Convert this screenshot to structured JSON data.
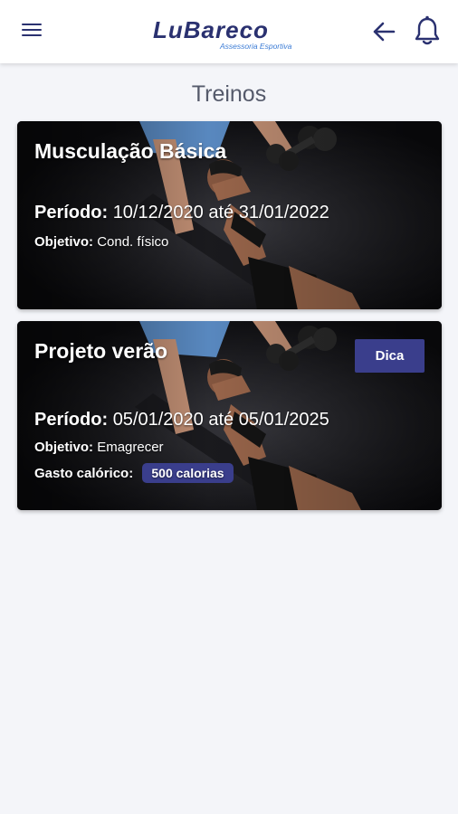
{
  "header": {
    "logo_main": "LuBareco",
    "logo_tagline": "Assessoria Esportiva",
    "menu_icon": "hamburger-menu-icon",
    "back_icon": "arrow-left-icon",
    "notification_icon": "bell-icon"
  },
  "page": {
    "title": "Treinos"
  },
  "workouts": [
    {
      "name": "Musculação Básica",
      "period_label": "Período:",
      "period_value": "10/12/2020 até 31/01/2022",
      "goal_label": "Objetivo:",
      "goal_value": "Cond. físico"
    },
    {
      "name": "Projeto verão",
      "tip_label": "Dica",
      "period_label": "Período:",
      "period_value": "05/01/2020 até 05/01/2025",
      "goal_label": "Objetivo:",
      "goal_value": "Emagrecer",
      "calorie_label": "Gasto calórico:",
      "calorie_value": "500 calorias"
    }
  ],
  "colors": {
    "brand": "#2a3170",
    "accent": "#3a3e8c",
    "background": "#f4f5f9"
  }
}
